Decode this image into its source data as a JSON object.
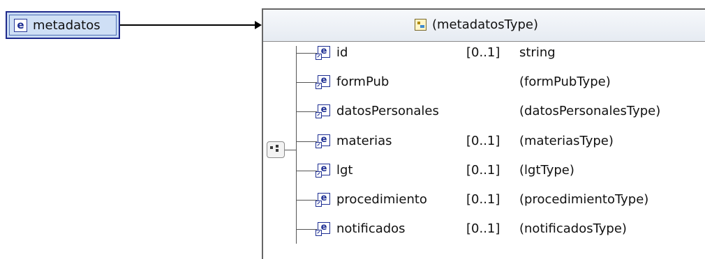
{
  "root": {
    "label": "metadatos",
    "badge": "e"
  },
  "type_box": {
    "title": "(metadatosType)"
  },
  "rows": [
    {
      "name": "id",
      "occurrence": "[0..1]",
      "type": "string"
    },
    {
      "name": "formPub",
      "occurrence": "",
      "type": "(formPubType)"
    },
    {
      "name": "datosPersonales",
      "occurrence": "",
      "type": "(datosPersonalesType)"
    },
    {
      "name": "materias",
      "occurrence": "[0..1]",
      "type": "(materiasType)"
    },
    {
      "name": "lgt",
      "occurrence": "[0..1]",
      "type": "(lgtType)"
    },
    {
      "name": "procedimiento",
      "occurrence": "[0..1]",
      "type": "(procedimientoType)"
    },
    {
      "name": "notificados",
      "occurrence": "[0..1]",
      "type": "(notificadosType)"
    }
  ],
  "icons": {
    "element": "element-ref-icon",
    "type": "complex-type-icon",
    "compositor": "sequence-compositor-icon"
  }
}
